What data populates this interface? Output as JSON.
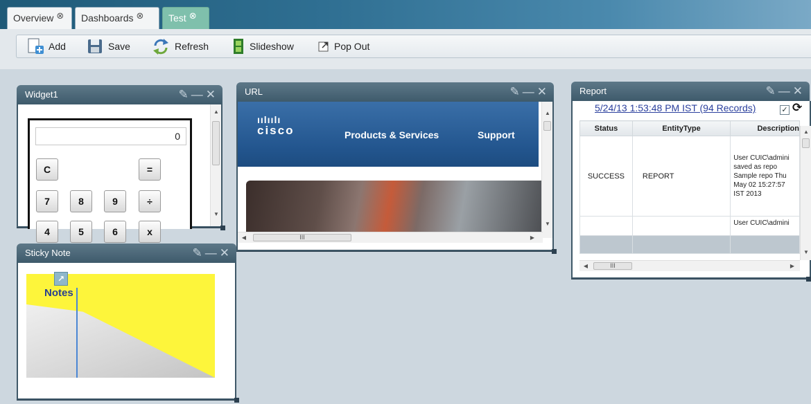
{
  "tabs": [
    {
      "label": "Overview",
      "close": "⊗",
      "active": false
    },
    {
      "label": "Dashboards",
      "close": "⊗",
      "active": false
    },
    {
      "label": "Test",
      "close": "⊗",
      "active": true
    }
  ],
  "toolbar": {
    "add": "Add",
    "save": "Save",
    "refresh": "Refresh",
    "slideshow": "Slideshow",
    "popout": "Pop Out"
  },
  "widgets": {
    "widget1": {
      "title": "Widget1",
      "calculator": {
        "display": "0",
        "keys": [
          "C",
          "=",
          "7",
          "8",
          "9",
          "÷",
          "4",
          "5",
          "6",
          "x"
        ]
      }
    },
    "url": {
      "title": "URL",
      "site": {
        "logo_text": "cisco",
        "nav": [
          "Products & Services",
          "Support"
        ],
        "scroll_thumb_marker": "III"
      }
    },
    "report": {
      "title": "Report",
      "link": "5/24/13 1:53:48 PM IST (94 Records)",
      "checkbox_mark": "✓",
      "columns": [
        "Status",
        "EntityType",
        "Description"
      ],
      "rows": [
        [
          "SUCCESS",
          "REPORT",
          "User CUIC\\admini saved as repo Sample repo Thu May 02 15:27:57 IST 2013"
        ],
        [
          "",
          "",
          "User CUIC\\admini"
        ]
      ],
      "scroll_thumb_marker": "III"
    },
    "sticky": {
      "title": "Sticky Note",
      "note_label": "Notes"
    }
  },
  "colors": {
    "header": "#3e5a6b",
    "active_tab": "#7fc0ac",
    "note_yellow": "#fdf53b",
    "cisco_blue": "#23568f"
  }
}
